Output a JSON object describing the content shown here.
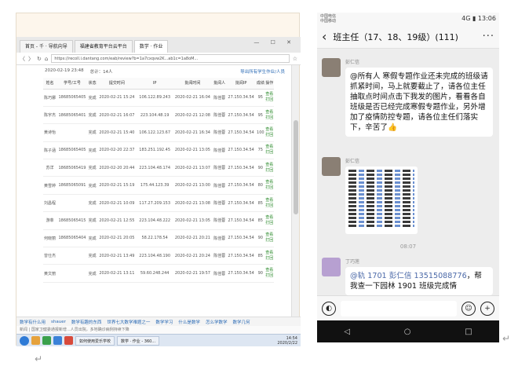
{
  "browser": {
    "tabs": [
      "首页 - 千 · 导航向导",
      "福建省教育平台云平台",
      "数学 · 作业"
    ],
    "window_controls": "— ☐ ✕",
    "url": "https://recoll.i.dantang.com/eab/review?b=1a7cxqvw2K...ab1c=1a8oM...",
    "meta": {
      "date_label": "2020-02-19 23:48",
      "total_label": "总计：14人",
      "export_link": "导出所有学生作业/人员"
    },
    "table": {
      "headers": [
        "姓名",
        "学号/工号",
        "状态",
        "提交时间",
        "IP",
        "批阅时间",
        "批阅人",
        "批阅IP",
        "成绩",
        "操作"
      ],
      "rows": [
        [
          "陈巧娜",
          "18685065405",
          "完成",
          "2020-02-21 15:24",
          "106.122.89.243",
          "2020-02-21 16:04",
          "陈佳蓉",
          "27.150.34.54",
          "95",
          "查看\n打回"
        ],
        [
          "陈宇杰",
          "18685065401",
          "完成",
          "2020-02-21 16:07",
          "223.104.48.19",
          "2020-02-21 12:08",
          "陈佳蓉",
          "27.150.34.54",
          "95",
          "查看\n打回"
        ],
        [
          "黄诗怡",
          "",
          "完成",
          "2020-02-21 15:40",
          "106.122.123.67",
          "2020-02-21 16:34",
          "陈佳蓉",
          "27.150.34.54",
          "100",
          "查看\n打回"
        ],
        [
          "陈子涵",
          "18685065405",
          "完成",
          "2020-02-20 22:37",
          "183.251.192.45",
          "2020-02-21 13:05",
          "陈佳蓉",
          "27.150.34.54",
          "75",
          "查看\n打回"
        ],
        [
          "苏洋",
          "18685065419",
          "完成",
          "2020-02-20 20:44",
          "223.104.48.174",
          "2020-02-21 13:07",
          "陈佳蓉",
          "27.150.34.54",
          "90",
          "查看\n打回"
        ],
        [
          "黄雪婷",
          "18685065091",
          "完成",
          "2020-02-21 15:19",
          "175.44.123.39",
          "2020-02-21 13:00",
          "陈佳蓉",
          "27.150.34.54",
          "80",
          "查看\n打回"
        ],
        [
          "刘昌程",
          "",
          "完成",
          "2020-02-21 10:09",
          "117.27.209.153",
          "2020-02-21 13:08",
          "陈佳蓉",
          "27.150.34.54",
          "85",
          "查看\n打回"
        ],
        [
          "游菲",
          "18685065415",
          "完成",
          "2020-02-21 12:55",
          "223.104.48.222",
          "2020-02-21 13:05",
          "陈佳蓉",
          "27.150.34.54",
          "85",
          "查看\n打回"
        ],
        [
          "何晓丽",
          "18685065404",
          "完成",
          "2020-02-21 20:05",
          "58.22.178.54",
          "2020-02-21 20:21",
          "陈佳蓉",
          "27.150.34.54",
          "90",
          "查看\n打回"
        ],
        [
          "曾仕杰",
          "",
          "完成",
          "2020-02-21 13:49",
          "223.104.48.190",
          "2020-02-21 20:24",
          "陈佳蓉",
          "27.150.34.54",
          "85",
          "查看\n打回"
        ],
        [
          "黄文丽",
          "",
          "完成",
          "2020-02-21 13:11",
          "59.60.248.244",
          "2020-02-21 19:57",
          "陈佳蓉",
          "27.150.34.54",
          "90",
          "查看\n打回"
        ]
      ]
    },
    "favorites": [
      "数学有什么用",
      "shauer",
      "数学有趣的东西",
      "世界七大数学难题之一",
      "数学学习",
      "什么是数学",
      "怎么学数学",
      "数学几何"
    ],
    "status": "新闻 | 国家卫健委通报新增...人员出院，多地确诊病例持续下降",
    "taskbar_buttons": [
      "如何使用爱乐学校",
      "数学 · 作业 - 360..."
    ],
    "clock": [
      "14:54",
      "2020/2/22"
    ]
  },
  "phone": {
    "carrier": [
      "中国电信",
      "中国移动"
    ],
    "status_right": "4G ▮ 13:06",
    "chat_title": "班主任（17、18、19级）(111)",
    "messages": [
      {
        "sender": "彭仁信",
        "text": "@所有人 寒假专题作业还未完成的班级请抓紧时间，马上就要截止了，请各位主任抽取点时间点击下我发的图片，看看各自班级是否已经完成寒假专题作业，另外增加了疫情防控专题，请各位主任们落实下，辛苦了👍"
      },
      {
        "sender": "彭仁信",
        "text": ""
      },
      {
        "sender": "丁巧莲",
        "mention_prefix": "@轨 1701 彭仁信 ",
        "phone": "13515088776",
        "text_suffix": "，帮我查一下园林 1901 班级完成情"
      }
    ],
    "timestamp": "08:07",
    "voice_icon": "voice-icon",
    "emoji_icon": "emoji-icon",
    "plus_icon": "plus-icon",
    "nav": [
      "◁",
      "○",
      "□"
    ]
  },
  "marks": [
    "↵",
    "↵"
  ]
}
